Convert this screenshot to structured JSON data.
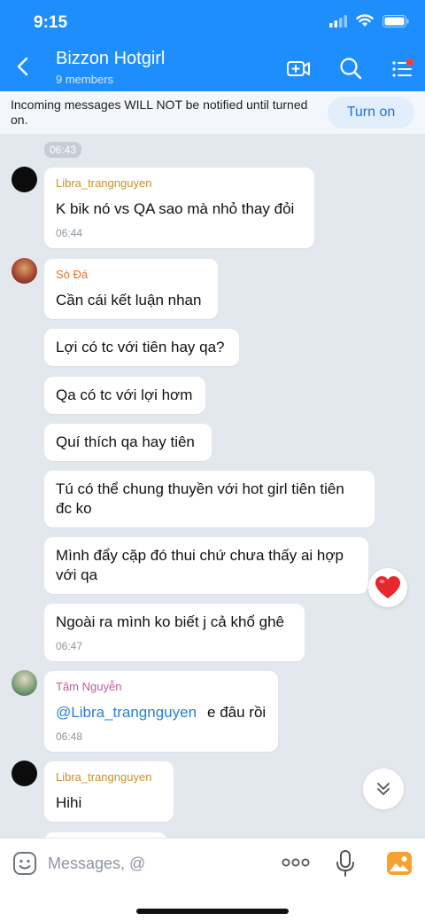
{
  "status_bar": {
    "time": "9:15"
  },
  "header": {
    "title": "Bizzon Hotgirl",
    "subtitle": "9 members",
    "icons": [
      "back-chevron-icon",
      "video-call-icon",
      "search-icon",
      "menu-list-icon"
    ],
    "notification_dot_color": "#ff3b30"
  },
  "notice": {
    "text": "Incoming messages WILL NOT be notified until turned on.",
    "button_label": "Turn on"
  },
  "chat": {
    "timestamp_pill": "06:43",
    "messages": [
      {
        "sender": "Libra_trangnguyen",
        "sender_color": "#c7922b",
        "text": "K bik nó vs QA sao mà nhỏ thay đỏi",
        "time": "06:44"
      },
      {
        "sender": "Sò Đá",
        "sender_color": "#e2742c",
        "text": "Cần cái kết luận nhan"
      },
      {
        "text": "Lợi có tc với tiên hay qa?"
      },
      {
        "text": "Qa có tc với lợi hơm"
      },
      {
        "text": "Quí thích qa hay tiên"
      },
      {
        "text": "Tú có thể chung thuyền với hot girl tiên tiên đc ko"
      },
      {
        "text": "Mình đẩy cặp đó thui chứ chưa thấy ai hợp với qa",
        "reaction": "heart-icon"
      },
      {
        "text": "Ngoài ra mình ko biết j cả khổ ghê",
        "time": "06:47"
      },
      {
        "sender": "Tâm Nguyễn",
        "sender_color": "#c05a9f",
        "mention": "@Libra_trangnguyen",
        "text": "e đâu rồi",
        "time": "06:48"
      },
      {
        "sender": "Libra_trangnguyen",
        "sender_color": "#c7922b",
        "text": "Hihi"
      }
    ]
  },
  "composer": {
    "placeholder": "Messages, @",
    "icons": [
      "emoji-icon",
      "more-options-icon",
      "microphone-icon",
      "photo-icon"
    ],
    "photo_icon_color": "#f7a130"
  },
  "colors": {
    "header_bg": "#1e8efd",
    "chat_bg": "#e3e8ef",
    "accent": "#1b74db"
  }
}
